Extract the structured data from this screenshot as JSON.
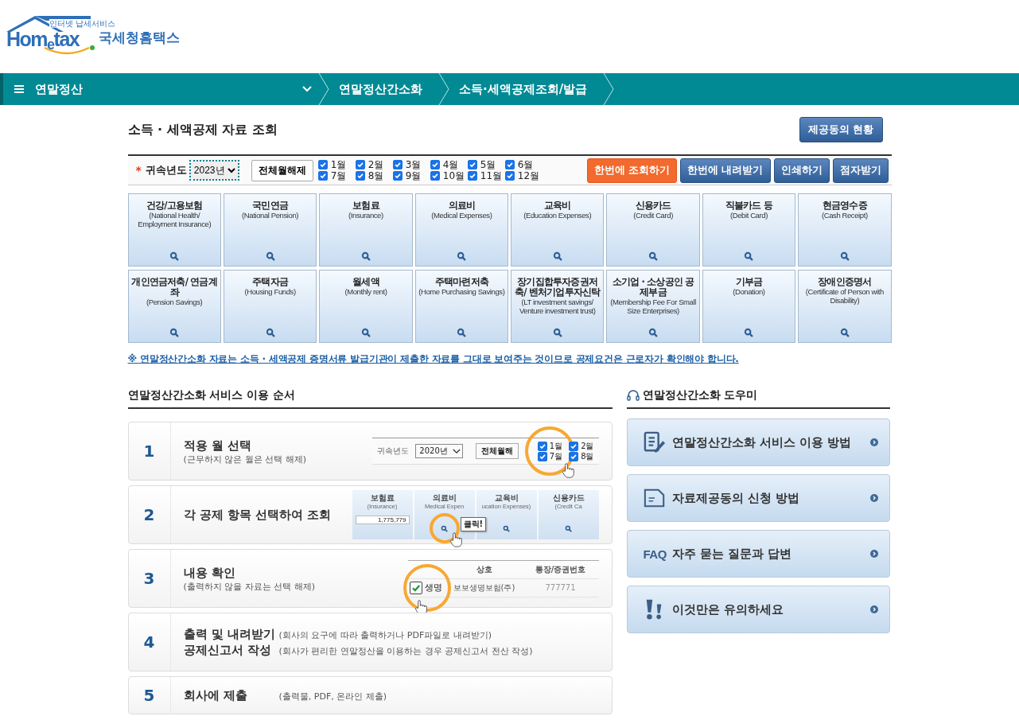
{
  "logo": {
    "tagline": "인터넷 납세서비스",
    "wordmark": "Hom$_{e}$tax",
    "name": "국세청홈택스"
  },
  "nav": {
    "menu": "연말정산",
    "crumbs": [
      "연말정산간소화",
      "소득·세액공제조회/발급"
    ]
  },
  "page_title": "소득 · 세액공제 자료 조회",
  "status_button": "제공동의 현황",
  "filter": {
    "required_mark": "*",
    "year_label": "귀속년도",
    "year": "2023년",
    "clear_button": "전체월해제",
    "months": [
      {
        "label": "1월",
        "checked": true
      },
      {
        "label": "2월",
        "checked": true
      },
      {
        "label": "3월",
        "checked": true
      },
      {
        "label": "4월",
        "checked": true
      },
      {
        "label": "5월",
        "checked": true
      },
      {
        "label": "6월",
        "checked": true
      },
      {
        "label": "7월",
        "checked": true
      },
      {
        "label": "8월",
        "checked": true
      },
      {
        "label": "9월",
        "checked": true
      },
      {
        "label": "10월",
        "checked": true
      },
      {
        "label": "11월",
        "checked": true
      },
      {
        "label": "12월",
        "checked": true
      }
    ],
    "buttons": [
      {
        "label": "한번에 조회하기",
        "kind": "primary"
      },
      {
        "label": "한번에 내려받기",
        "kind": "secondary"
      },
      {
        "label": "인쇄하기",
        "kind": "secondary"
      },
      {
        "label": "점자받기",
        "kind": "secondary"
      }
    ]
  },
  "categories": [
    {
      "title": "건강/고용보험",
      "subtitle": "(National Health/ Employment Insurance)"
    },
    {
      "title": "국민연금",
      "subtitle": "(National Pension)"
    },
    {
      "title": "보험료",
      "subtitle": "(Insurance)"
    },
    {
      "title": "의료비",
      "subtitle": "(Medical Expenses)"
    },
    {
      "title": "교육비",
      "subtitle": "(Education Expenses)"
    },
    {
      "title": "신용카드",
      "subtitle": "(Credit Card)"
    },
    {
      "title": "직불카드 등",
      "subtitle": "(Debit Card)"
    },
    {
      "title": "현금영수증",
      "subtitle": "(Cash Receipt)"
    },
    {
      "title": "개인연금저축/ 연금계좌",
      "subtitle": "(Pension Savings)"
    },
    {
      "title": "주택자금",
      "subtitle": "(Housing Funds)"
    },
    {
      "title": "월세액",
      "subtitle": "(Monthly rent)"
    },
    {
      "title": "주택마련저축",
      "subtitle": "(Home Purchasing Savings)"
    },
    {
      "title": "장기집합투자증권저축/ 벤처기업투자신탁",
      "subtitle": "(LT investment savings/ Venture investment trust)"
    },
    {
      "title": "소기업 · 소상공인 공제부금",
      "subtitle": "(Membership Fee For Small Size Enterprises)"
    },
    {
      "title": "기부금",
      "subtitle": "(Donation)"
    },
    {
      "title": "장애인증명서",
      "subtitle": "(Certificate of Person with Disability)"
    }
  ],
  "notice": "※ 연말정산간소화 자료는 소득 · 세액공제 증명서류 발급기관이 제출한 자료를 그대로 보여주는 것이므로 공제요건은 근로자가 확인해야 합니다.",
  "steps_title": "연말정산간소화 서비스 이용 순서",
  "steps": [
    {
      "number": "1",
      "kind": "stacked",
      "lines": [
        {
          "title": "적용 월 선택",
          "note": "(근무하지 않은 월은 선택 해제)"
        }
      ],
      "illustration": {
        "kind": "month_picker",
        "year_label": "귀속년도",
        "year": "2020년",
        "clear_button": "전체월해",
        "months": [
          {
            "label": "1월",
            "checked": true
          },
          {
            "label": "2월",
            "checked": true
          },
          {
            "label": "7월",
            "checked": true
          },
          {
            "label": "8월",
            "checked": true
          }
        ]
      }
    },
    {
      "number": "2",
      "kind": "stacked",
      "lines": [
        {
          "title": "각 공제 항목 선택하여 조회"
        }
      ],
      "illustration": {
        "kind": "category_tiles",
        "callout": "클릭!",
        "tiles": [
          {
            "title": "보험료",
            "subtitle": "(Insurance)",
            "amount": "1,775,779",
            "selected": false
          },
          {
            "title": "의료비",
            "subtitle": "Medical Expen",
            "selected": true
          },
          {
            "title": "교육비",
            "subtitle": "ucation Expenses)",
            "selected": false
          },
          {
            "title": "신용카드",
            "subtitle": "(Credit Ca",
            "selected": false
          }
        ]
      }
    },
    {
      "number": "3",
      "kind": "stacked",
      "lines": [
        {
          "title": "내용 확인",
          "note": "(출력하지 않을 자료는 선택 해제)"
        }
      ],
      "illustration": {
        "kind": "result_table",
        "columns": [
          "상호",
          "통장/증권번호"
        ],
        "rows": [
          {
            "checked": true,
            "label": "생명",
            "company": "보보생명보험(주)",
            "account": "777771"
          }
        ]
      }
    },
    {
      "number": "4",
      "kind": "inline",
      "lines": [
        {
          "title": "출력 및 내려받기",
          "note": "(회사의 요구에 따라 출력하거나 PDF파일로 내려받기)"
        },
        {
          "title": "공제신고서 작성",
          "note": "(회사가 편리한 연말정산을 이용하는 경우 공제신고서 전산 작성)"
        }
      ]
    },
    {
      "number": "5",
      "kind": "inline",
      "lines": [
        {
          "title": "회사에 제출",
          "note": "(출력물, PDF, 온라인 제출)"
        }
      ]
    }
  ],
  "helper": {
    "title": "연말정산간소화 도우미",
    "items": [
      {
        "kind": "guide",
        "label": "연말정산간소화 서비스 이용 방법"
      },
      {
        "kind": "document",
        "label": "자료제공동의 신청 방법"
      },
      {
        "kind": "faq",
        "badge": "FAQ",
        "label": "자주 묻는 질문과 답변"
      },
      {
        "kind": "notice",
        "label": "이것만은 유의하세요"
      }
    ]
  }
}
